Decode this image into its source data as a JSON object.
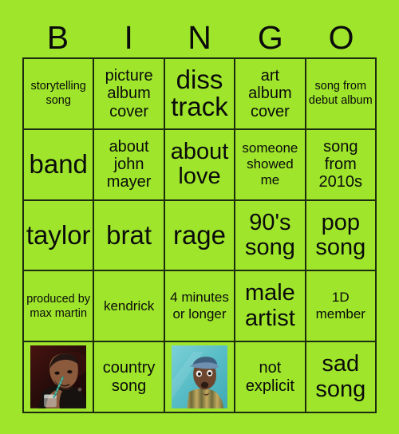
{
  "card": {
    "title": "BINGO",
    "background_color": "#9ee52b",
    "line_color": "#1d2b10",
    "text_color": "#0b0b0b"
  },
  "header": {
    "letters": [
      "B",
      "I",
      "N",
      "G",
      "O"
    ]
  },
  "grid": {
    "rows": 5,
    "columns": 5,
    "cells": [
      [
        {
          "type": "text",
          "text": "storytelling song",
          "size": "fs-xs"
        },
        {
          "type": "text",
          "text": "picture album cover",
          "size": "fs-m"
        },
        {
          "type": "text",
          "text": "diss track",
          "size": "fs-xxl"
        },
        {
          "type": "text",
          "text": "art album cover",
          "size": "fs-m"
        },
        {
          "type": "text",
          "text": "song from debut album",
          "size": "fs-xs"
        }
      ],
      [
        {
          "type": "text",
          "text": "band",
          "size": "fs-xxl"
        },
        {
          "type": "text",
          "text": "about john mayer",
          "size": "fs-m"
        },
        {
          "type": "text",
          "text": "about love",
          "size": "fs-xl"
        },
        {
          "type": "text",
          "text": "someone showed me",
          "size": "fs-s"
        },
        {
          "type": "text",
          "text": "song from 2010s",
          "size": "fs-m"
        }
      ],
      [
        {
          "type": "text",
          "text": "taylor",
          "size": "fs-xxl"
        },
        {
          "type": "text",
          "text": "brat",
          "size": "fs-xxl"
        },
        {
          "type": "text",
          "text": "rage",
          "size": "fs-xxl"
        },
        {
          "type": "text",
          "text": "90's song",
          "size": "fs-xl"
        },
        {
          "type": "text",
          "text": "pop song",
          "size": "fs-xl"
        }
      ],
      [
        {
          "type": "text",
          "text": "produced by max martin",
          "size": "fs-xs"
        },
        {
          "type": "text",
          "text": "kendrick",
          "size": "fs-s"
        },
        {
          "type": "text",
          "text": "4 minutes or longer",
          "size": "fs-s"
        },
        {
          "type": "text",
          "text": "male artist",
          "size": "fs-xl"
        },
        {
          "type": "text",
          "text": "1D member",
          "size": "fs-s"
        }
      ],
      [
        {
          "type": "photo",
          "photo": "drake-photo",
          "alt": "man drinking through a straw",
          "text": ""
        },
        {
          "type": "text",
          "text": "country song",
          "size": "fs-m"
        },
        {
          "type": "photo",
          "photo": "tyler-photo",
          "alt": "man in cap and striped shirt",
          "text": ""
        },
        {
          "type": "text",
          "text": "not explicit",
          "size": "fs-m"
        },
        {
          "type": "text",
          "text": "sad song",
          "size": "fs-xl"
        }
      ]
    ]
  }
}
